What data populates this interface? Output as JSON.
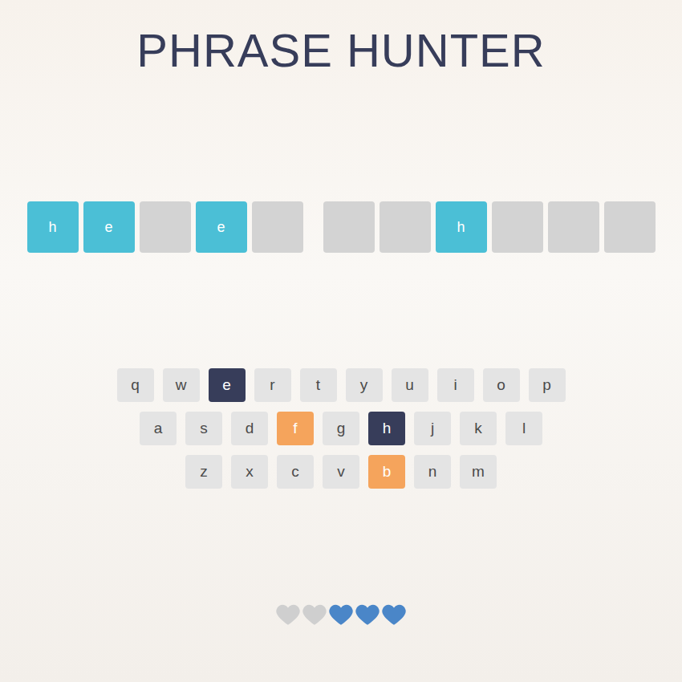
{
  "title": "PHRASE HUNTER",
  "phrase": {
    "words": [
      {
        "tiles": [
          {
            "letter": "h",
            "shown": true
          },
          {
            "letter": "e",
            "shown": true
          },
          {
            "letter": "",
            "shown": false
          },
          {
            "letter": "e",
            "shown": true
          },
          {
            "letter": "",
            "shown": false
          }
        ]
      },
      {
        "tiles": [
          {
            "letter": "",
            "shown": false
          },
          {
            "letter": "",
            "shown": false
          },
          {
            "letter": "h",
            "shown": true
          },
          {
            "letter": "",
            "shown": false
          },
          {
            "letter": "",
            "shown": false
          },
          {
            "letter": "",
            "shown": false
          }
        ]
      }
    ]
  },
  "keyboard": {
    "rows": [
      [
        {
          "key": "q",
          "chosen": false,
          "wrong": false
        },
        {
          "key": "w",
          "chosen": false,
          "wrong": false
        },
        {
          "key": "e",
          "chosen": true,
          "wrong": false
        },
        {
          "key": "r",
          "chosen": false,
          "wrong": false
        },
        {
          "key": "t",
          "chosen": false,
          "wrong": false
        },
        {
          "key": "y",
          "chosen": false,
          "wrong": false
        },
        {
          "key": "u",
          "chosen": false,
          "wrong": false
        },
        {
          "key": "i",
          "chosen": false,
          "wrong": false
        },
        {
          "key": "o",
          "chosen": false,
          "wrong": false
        },
        {
          "key": "p",
          "chosen": false,
          "wrong": false
        }
      ],
      [
        {
          "key": "a",
          "chosen": false,
          "wrong": false
        },
        {
          "key": "s",
          "chosen": false,
          "wrong": false
        },
        {
          "key": "d",
          "chosen": false,
          "wrong": false
        },
        {
          "key": "f",
          "chosen": true,
          "wrong": true
        },
        {
          "key": "g",
          "chosen": false,
          "wrong": false
        },
        {
          "key": "h",
          "chosen": true,
          "wrong": false
        },
        {
          "key": "j",
          "chosen": false,
          "wrong": false
        },
        {
          "key": "k",
          "chosen": false,
          "wrong": false
        },
        {
          "key": "l",
          "chosen": false,
          "wrong": false
        }
      ],
      [
        {
          "key": "z",
          "chosen": false,
          "wrong": false
        },
        {
          "key": "x",
          "chosen": false,
          "wrong": false
        },
        {
          "key": "c",
          "chosen": false,
          "wrong": false
        },
        {
          "key": "v",
          "chosen": false,
          "wrong": false
        },
        {
          "key": "b",
          "chosen": true,
          "wrong": true
        },
        {
          "key": "n",
          "chosen": false,
          "wrong": false
        },
        {
          "key": "m",
          "chosen": false,
          "wrong": false
        }
      ]
    ]
  },
  "lives": [
    {
      "lost": true
    },
    {
      "lost": true
    },
    {
      "lost": false
    },
    {
      "lost": false
    },
    {
      "lost": false
    }
  ]
}
